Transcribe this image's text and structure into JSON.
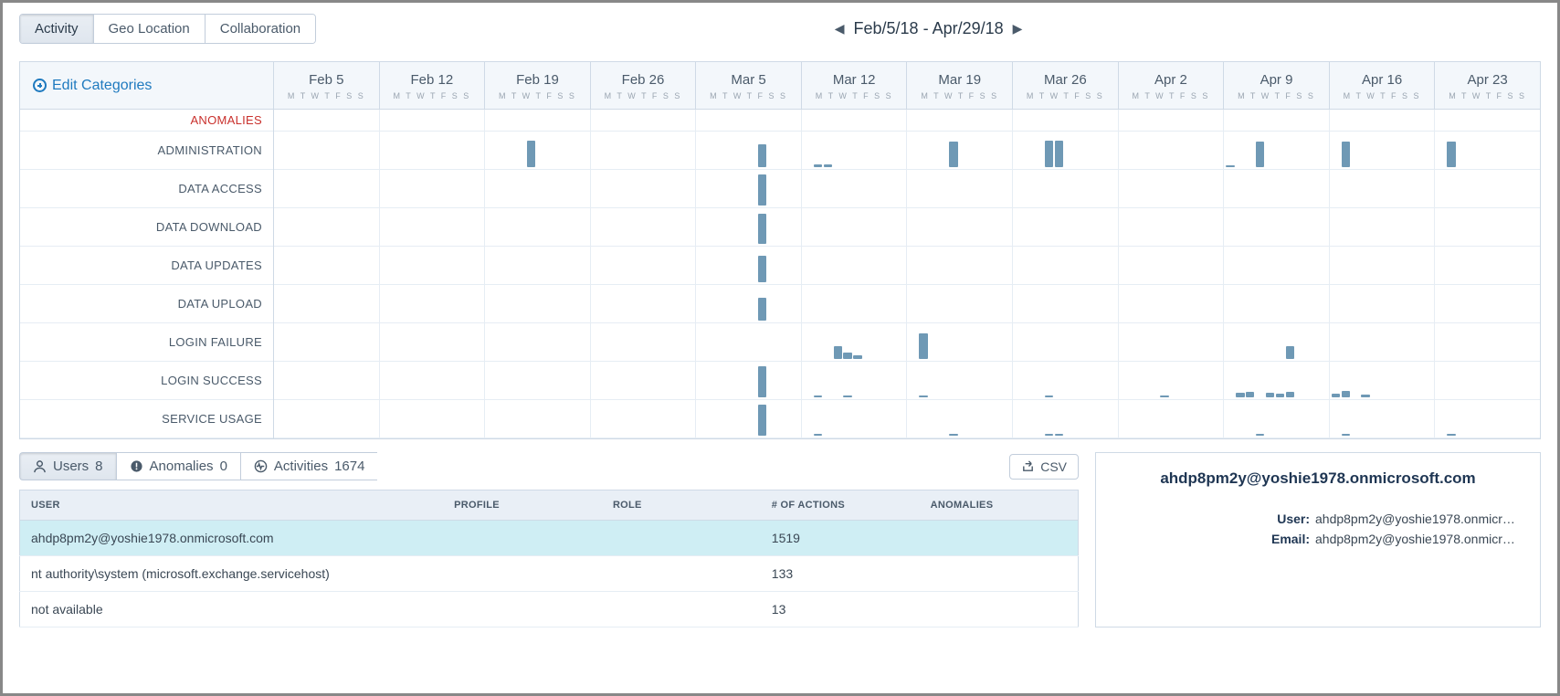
{
  "tabs": {
    "activity": "Activity",
    "geo": "Geo Location",
    "collab": "Collaboration"
  },
  "date_range": "Feb/5/18 - Apr/29/18",
  "edit_categories": "Edit Categories",
  "day_letters": "M T W T F S S",
  "weeks": [
    "Feb 5",
    "Feb 12",
    "Feb 19",
    "Feb 26",
    "Mar 5",
    "Mar 12",
    "Mar 19",
    "Mar 26",
    "Apr 2",
    "Apr 9",
    "Apr 16",
    "Apr 23"
  ],
  "categories": [
    {
      "name": "ANOMALIES",
      "special": "anom"
    },
    {
      "name": "ADMINISTRATION"
    },
    {
      "name": "DATA ACCESS"
    },
    {
      "name": "DATA DOWNLOAD"
    },
    {
      "name": "DATA UPDATES"
    },
    {
      "name": "DATA UPLOAD"
    },
    {
      "name": "LOGIN FAILURE"
    },
    {
      "name": "LOGIN SUCCESS"
    },
    {
      "name": "SERVICE USAGE"
    }
  ],
  "chart_data": {
    "type": "bar",
    "xlabel": "",
    "ylabel": "",
    "note": "Daily activity histogram per category across 12 weeks. Values are relative bar heights 0-1 (1 = full row). Only non-zero days listed.",
    "series": [
      {
        "name": "ANOMALIES",
        "bars": []
      },
      {
        "name": "ADMINISTRATION",
        "bars": [
          {
            "week": 2,
            "day": 4,
            "h": 0.8
          },
          {
            "week": 4,
            "day": 6,
            "h": 0.7
          },
          {
            "week": 5,
            "day": 1,
            "h": 0.07
          },
          {
            "week": 5,
            "day": 2,
            "h": 0.07
          },
          {
            "week": 6,
            "day": 4,
            "h": 0.78
          },
          {
            "week": 7,
            "day": 3,
            "h": 0.8
          },
          {
            "week": 7,
            "day": 4,
            "h": 0.8
          },
          {
            "week": 9,
            "day": 0,
            "h": 0.05
          },
          {
            "week": 9,
            "day": 3,
            "h": 0.78
          },
          {
            "week": 10,
            "day": 1,
            "h": 0.78
          },
          {
            "week": 11,
            "day": 1,
            "h": 0.78
          }
        ]
      },
      {
        "name": "DATA ACCESS",
        "bars": [
          {
            "week": 4,
            "day": 6,
            "h": 0.95
          }
        ]
      },
      {
        "name": "DATA DOWNLOAD",
        "bars": [
          {
            "week": 4,
            "day": 6,
            "h": 0.92
          }
        ]
      },
      {
        "name": "DATA UPDATES",
        "bars": [
          {
            "week": 4,
            "day": 6,
            "h": 0.8
          }
        ]
      },
      {
        "name": "DATA UPLOAD",
        "bars": [
          {
            "week": 4,
            "day": 6,
            "h": 0.7
          }
        ]
      },
      {
        "name": "LOGIN FAILURE",
        "bars": [
          {
            "week": 5,
            "day": 3,
            "h": 0.4
          },
          {
            "week": 5,
            "day": 4,
            "h": 0.2
          },
          {
            "week": 5,
            "day": 5,
            "h": 0.1
          },
          {
            "week": 6,
            "day": 1,
            "h": 0.78
          },
          {
            "week": 9,
            "day": 6,
            "h": 0.38
          }
        ]
      },
      {
        "name": "LOGIN SUCCESS",
        "bars": [
          {
            "week": 4,
            "day": 6,
            "h": 0.95
          },
          {
            "week": 5,
            "day": 1,
            "h": 0.05
          },
          {
            "week": 5,
            "day": 4,
            "h": 0.05
          },
          {
            "week": 6,
            "day": 1,
            "h": 0.05
          },
          {
            "week": 7,
            "day": 3,
            "h": 0.05
          },
          {
            "week": 8,
            "day": 4,
            "h": 0.05
          },
          {
            "week": 9,
            "day": 1,
            "h": 0.15
          },
          {
            "week": 9,
            "day": 2,
            "h": 0.18
          },
          {
            "week": 9,
            "day": 4,
            "h": 0.15
          },
          {
            "week": 9,
            "day": 5,
            "h": 0.12
          },
          {
            "week": 9,
            "day": 6,
            "h": 0.18
          },
          {
            "week": 10,
            "day": 0,
            "h": 0.1
          },
          {
            "week": 10,
            "day": 1,
            "h": 0.2
          },
          {
            "week": 10,
            "day": 3,
            "h": 0.08
          }
        ]
      },
      {
        "name": "SERVICE USAGE",
        "bars": [
          {
            "week": 4,
            "day": 6,
            "h": 0.95
          },
          {
            "week": 5,
            "day": 1,
            "h": 0.05
          },
          {
            "week": 6,
            "day": 4,
            "h": 0.05
          },
          {
            "week": 7,
            "day": 3,
            "h": 0.05
          },
          {
            "week": 7,
            "day": 4,
            "h": 0.05
          },
          {
            "week": 9,
            "day": 3,
            "h": 0.05
          },
          {
            "week": 10,
            "day": 1,
            "h": 0.05
          },
          {
            "week": 11,
            "day": 1,
            "h": 0.05
          }
        ]
      }
    ]
  },
  "lower_tabs": {
    "users": {
      "label": "Users",
      "count": "8"
    },
    "anomalies": {
      "label": "Anomalies",
      "count": "0"
    },
    "activities": {
      "label": "Activities",
      "count": "1674"
    }
  },
  "csv_label": "CSV",
  "table": {
    "cols": [
      "USER",
      "PROFILE",
      "ROLE",
      "# OF ACTIONS",
      "ANOMALIES"
    ],
    "rows": [
      {
        "user": "ahdp8pm2y@yoshie1978.onmicrosoft.com",
        "profile": "",
        "role": "",
        "actions": "1519",
        "anomalies": "",
        "selected": true
      },
      {
        "user": "nt authority\\system (microsoft.exchange.servicehost)",
        "profile": "",
        "role": "",
        "actions": "133",
        "anomalies": ""
      },
      {
        "user": "not available",
        "profile": "",
        "role": "",
        "actions": "13",
        "anomalies": ""
      }
    ]
  },
  "detail": {
    "title": "ahdp8pm2y@yoshie1978.onmicrosoft.com",
    "user_k": "User:",
    "user_v": "ahdp8pm2y@yoshie1978.onmicrosoft.co…",
    "email_k": "Email:",
    "email_v": "ahdp8pm2y@yoshie1978.onmicrosoft.co…"
  }
}
